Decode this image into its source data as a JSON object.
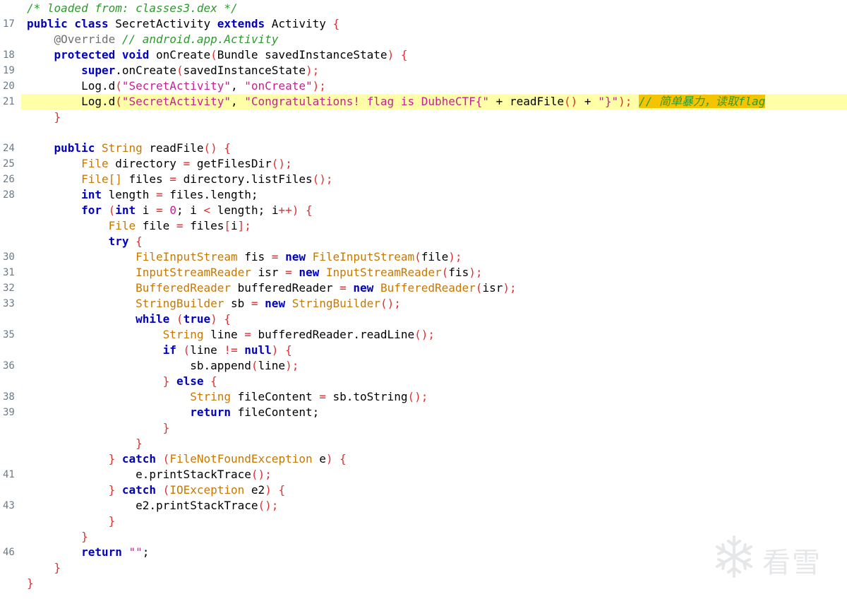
{
  "editor": {
    "lines": [
      {
        "num": "",
        "hl": false,
        "tokens": [
          {
            "t": "/* loaded from: classes3.dex */",
            "c": "cmt"
          }
        ]
      },
      {
        "num": "17",
        "hl": false,
        "tokens": [
          {
            "t": "public class",
            "c": "kw"
          },
          {
            "t": " SecretActivity ",
            "c": "id"
          },
          {
            "t": "extends",
            "c": "kw"
          },
          {
            "t": " Activity ",
            "c": "id"
          },
          {
            "t": "{",
            "c": "pn"
          }
        ]
      },
      {
        "num": "",
        "hl": false,
        "tokens": [
          {
            "t": "    "
          },
          {
            "t": "@Override",
            "c": "ann"
          },
          {
            "t": " // android.app.Activity",
            "c": "cmt"
          }
        ]
      },
      {
        "num": "18",
        "hl": false,
        "tokens": [
          {
            "t": "    "
          },
          {
            "t": "protected void",
            "c": "kw"
          },
          {
            "t": " onCreate",
            "c": "id"
          },
          {
            "t": "(",
            "c": "pn"
          },
          {
            "t": "Bundle savedInstanceState",
            "c": "id"
          },
          {
            "t": ") {",
            "c": "pn"
          }
        ]
      },
      {
        "num": "19",
        "hl": false,
        "tokens": [
          {
            "t": "        "
          },
          {
            "t": "super",
            "c": "kw"
          },
          {
            "t": ".onCreate",
            "c": "id"
          },
          {
            "t": "(",
            "c": "pn"
          },
          {
            "t": "savedInstanceState",
            "c": "id"
          },
          {
            "t": ");",
            "c": "pn"
          }
        ]
      },
      {
        "num": "20",
        "hl": false,
        "tokens": [
          {
            "t": "        "
          },
          {
            "t": "Log.d",
            "c": "id"
          },
          {
            "t": "(",
            "c": "pn"
          },
          {
            "t": "\"SecretActivity\"",
            "c": "str"
          },
          {
            "t": ", ",
            "c": "id"
          },
          {
            "t": "\"onCreate\"",
            "c": "str"
          },
          {
            "t": ");",
            "c": "pn"
          }
        ]
      },
      {
        "num": "21",
        "hl": true,
        "tokens": [
          {
            "t": "        "
          },
          {
            "t": "Log.d",
            "c": "id"
          },
          {
            "t": "(",
            "c": "pn"
          },
          {
            "t": "\"SecretActivity\"",
            "c": "str"
          },
          {
            "t": ", ",
            "c": "id"
          },
          {
            "t": "\"Congratulations! flag is DubheCTF{\"",
            "c": "str"
          },
          {
            "t": " + ",
            "c": "id"
          },
          {
            "t": "readFile",
            "c": "id"
          },
          {
            "t": "()",
            "c": "pn"
          },
          {
            "t": " + ",
            "c": "id"
          },
          {
            "t": "\"}\"",
            "c": "str"
          },
          {
            "t": ");",
            "c": "pn"
          },
          {
            "t": " ",
            "c": "id"
          },
          {
            "t": "// 简单暴力，读取flag",
            "c": "hcmt"
          }
        ]
      },
      {
        "num": "",
        "hl": false,
        "tokens": [
          {
            "t": "    "
          },
          {
            "t": "}",
            "c": "pn"
          }
        ]
      },
      {
        "num": "",
        "hl": false,
        "tokens": []
      },
      {
        "num": "24",
        "hl": false,
        "tokens": [
          {
            "t": "    "
          },
          {
            "t": "public",
            "c": "kw"
          },
          {
            "t": " "
          },
          {
            "t": "String",
            "c": "type"
          },
          {
            "t": " readFile",
            "c": "id"
          },
          {
            "t": "() {",
            "c": "pn"
          }
        ]
      },
      {
        "num": "25",
        "hl": false,
        "tokens": [
          {
            "t": "        "
          },
          {
            "t": "File",
            "c": "type"
          },
          {
            "t": " directory ",
            "c": "id"
          },
          {
            "t": "=",
            "c": "op"
          },
          {
            "t": " getFilesDir",
            "c": "id"
          },
          {
            "t": "();",
            "c": "pn"
          }
        ]
      },
      {
        "num": "26",
        "hl": false,
        "tokens": [
          {
            "t": "        "
          },
          {
            "t": "File[]",
            "c": "type"
          },
          {
            "t": " files ",
            "c": "id"
          },
          {
            "t": "=",
            "c": "op"
          },
          {
            "t": " directory.listFiles",
            "c": "id"
          },
          {
            "t": "();",
            "c": "pn"
          }
        ]
      },
      {
        "num": "28",
        "hl": false,
        "tokens": [
          {
            "t": "        "
          },
          {
            "t": "int",
            "c": "kw"
          },
          {
            "t": " length ",
            "c": "id"
          },
          {
            "t": "=",
            "c": "op"
          },
          {
            "t": " files.length;",
            "c": "id"
          }
        ]
      },
      {
        "num": "",
        "hl": false,
        "tokens": [
          {
            "t": "        "
          },
          {
            "t": "for",
            "c": "kw"
          },
          {
            "t": " (",
            "c": "pn"
          },
          {
            "t": "int",
            "c": "kw"
          },
          {
            "t": " i ",
            "c": "id"
          },
          {
            "t": "=",
            "c": "op"
          },
          {
            "t": " "
          },
          {
            "t": "0",
            "c": "num"
          },
          {
            "t": "; i ",
            "c": "id"
          },
          {
            "t": "<",
            "c": "op"
          },
          {
            "t": " length; i",
            "c": "id"
          },
          {
            "t": "++",
            "c": "op"
          },
          {
            "t": ") {",
            "c": "pn"
          }
        ]
      },
      {
        "num": "",
        "hl": false,
        "tokens": [
          {
            "t": "            "
          },
          {
            "t": "File",
            "c": "type"
          },
          {
            "t": " file ",
            "c": "id"
          },
          {
            "t": "=",
            "c": "op"
          },
          {
            "t": " files",
            "c": "id"
          },
          {
            "t": "[",
            "c": "pn"
          },
          {
            "t": "i",
            "c": "id"
          },
          {
            "t": "];",
            "c": "pn"
          }
        ]
      },
      {
        "num": "",
        "hl": false,
        "tokens": [
          {
            "t": "            "
          },
          {
            "t": "try",
            "c": "kw"
          },
          {
            "t": " {",
            "c": "pn"
          }
        ]
      },
      {
        "num": "30",
        "hl": false,
        "tokens": [
          {
            "t": "                "
          },
          {
            "t": "FileInputStream",
            "c": "type"
          },
          {
            "t": " fis ",
            "c": "id"
          },
          {
            "t": "=",
            "c": "op"
          },
          {
            "t": " "
          },
          {
            "t": "new",
            "c": "kw"
          },
          {
            "t": " "
          },
          {
            "t": "FileInputStream",
            "c": "type"
          },
          {
            "t": "(",
            "c": "pn"
          },
          {
            "t": "file",
            "c": "id"
          },
          {
            "t": ");",
            "c": "pn"
          }
        ]
      },
      {
        "num": "31",
        "hl": false,
        "tokens": [
          {
            "t": "                "
          },
          {
            "t": "InputStreamReader",
            "c": "type"
          },
          {
            "t": " isr ",
            "c": "id"
          },
          {
            "t": "=",
            "c": "op"
          },
          {
            "t": " "
          },
          {
            "t": "new",
            "c": "kw"
          },
          {
            "t": " "
          },
          {
            "t": "InputStreamReader",
            "c": "type"
          },
          {
            "t": "(",
            "c": "pn"
          },
          {
            "t": "fis",
            "c": "id"
          },
          {
            "t": ");",
            "c": "pn"
          }
        ]
      },
      {
        "num": "32",
        "hl": false,
        "tokens": [
          {
            "t": "                "
          },
          {
            "t": "BufferedReader",
            "c": "type"
          },
          {
            "t": " bufferedReader ",
            "c": "id"
          },
          {
            "t": "=",
            "c": "op"
          },
          {
            "t": " "
          },
          {
            "t": "new",
            "c": "kw"
          },
          {
            "t": " "
          },
          {
            "t": "BufferedReader",
            "c": "type"
          },
          {
            "t": "(",
            "c": "pn"
          },
          {
            "t": "isr",
            "c": "id"
          },
          {
            "t": ");",
            "c": "pn"
          }
        ]
      },
      {
        "num": "33",
        "hl": false,
        "tokens": [
          {
            "t": "                "
          },
          {
            "t": "StringBuilder",
            "c": "type"
          },
          {
            "t": " sb ",
            "c": "id"
          },
          {
            "t": "=",
            "c": "op"
          },
          {
            "t": " "
          },
          {
            "t": "new",
            "c": "kw"
          },
          {
            "t": " "
          },
          {
            "t": "StringBuilder",
            "c": "type"
          },
          {
            "t": "();",
            "c": "pn"
          }
        ]
      },
      {
        "num": "",
        "hl": false,
        "tokens": [
          {
            "t": "                "
          },
          {
            "t": "while",
            "c": "kw"
          },
          {
            "t": " (",
            "c": "pn"
          },
          {
            "t": "true",
            "c": "kw"
          },
          {
            "t": ") {",
            "c": "pn"
          }
        ]
      },
      {
        "num": "35",
        "hl": false,
        "tokens": [
          {
            "t": "                    "
          },
          {
            "t": "String",
            "c": "type"
          },
          {
            "t": " line ",
            "c": "id"
          },
          {
            "t": "=",
            "c": "op"
          },
          {
            "t": " bufferedReader.readLine",
            "c": "id"
          },
          {
            "t": "();",
            "c": "pn"
          }
        ]
      },
      {
        "num": "",
        "hl": false,
        "tokens": [
          {
            "t": "                    "
          },
          {
            "t": "if",
            "c": "kw"
          },
          {
            "t": " (",
            "c": "pn"
          },
          {
            "t": "line ",
            "c": "id"
          },
          {
            "t": "!=",
            "c": "op"
          },
          {
            "t": " "
          },
          {
            "t": "null",
            "c": "kw"
          },
          {
            "t": ") {",
            "c": "pn"
          }
        ]
      },
      {
        "num": "36",
        "hl": false,
        "tokens": [
          {
            "t": "                        "
          },
          {
            "t": "sb.append",
            "c": "id"
          },
          {
            "t": "(",
            "c": "pn"
          },
          {
            "t": "line",
            "c": "id"
          },
          {
            "t": ");",
            "c": "pn"
          }
        ]
      },
      {
        "num": "",
        "hl": false,
        "tokens": [
          {
            "t": "                    "
          },
          {
            "t": "}",
            "c": "pn"
          },
          {
            "t": " "
          },
          {
            "t": "else",
            "c": "kw"
          },
          {
            "t": " {",
            "c": "pn"
          }
        ]
      },
      {
        "num": "38",
        "hl": false,
        "tokens": [
          {
            "t": "                        "
          },
          {
            "t": "String",
            "c": "type"
          },
          {
            "t": " fileContent ",
            "c": "id"
          },
          {
            "t": "=",
            "c": "op"
          },
          {
            "t": " sb.toString",
            "c": "id"
          },
          {
            "t": "();",
            "c": "pn"
          }
        ]
      },
      {
        "num": "39",
        "hl": false,
        "tokens": [
          {
            "t": "                        "
          },
          {
            "t": "return",
            "c": "kw"
          },
          {
            "t": " fileContent;",
            "c": "id"
          }
        ]
      },
      {
        "num": "",
        "hl": false,
        "tokens": [
          {
            "t": "                    "
          },
          {
            "t": "}",
            "c": "pn"
          }
        ]
      },
      {
        "num": "",
        "hl": false,
        "tokens": [
          {
            "t": "                "
          },
          {
            "t": "}",
            "c": "pn"
          }
        ]
      },
      {
        "num": "",
        "hl": false,
        "tokens": [
          {
            "t": "            "
          },
          {
            "t": "}",
            "c": "pn"
          },
          {
            "t": " "
          },
          {
            "t": "catch",
            "c": "kw"
          },
          {
            "t": " (",
            "c": "pn"
          },
          {
            "t": "FileNotFoundException",
            "c": "type"
          },
          {
            "t": " e",
            "c": "id"
          },
          {
            "t": ") {",
            "c": "pn"
          }
        ]
      },
      {
        "num": "41",
        "hl": false,
        "tokens": [
          {
            "t": "                "
          },
          {
            "t": "e.printStackTrace",
            "c": "id"
          },
          {
            "t": "();",
            "c": "pn"
          }
        ]
      },
      {
        "num": "",
        "hl": false,
        "tokens": [
          {
            "t": "            "
          },
          {
            "t": "}",
            "c": "pn"
          },
          {
            "t": " "
          },
          {
            "t": "catch",
            "c": "kw"
          },
          {
            "t": " (",
            "c": "pn"
          },
          {
            "t": "IOException",
            "c": "type"
          },
          {
            "t": " e2",
            "c": "id"
          },
          {
            "t": ") {",
            "c": "pn"
          }
        ]
      },
      {
        "num": "43",
        "hl": false,
        "tokens": [
          {
            "t": "                "
          },
          {
            "t": "e2.printStackTrace",
            "c": "id"
          },
          {
            "t": "();",
            "c": "pn"
          }
        ]
      },
      {
        "num": "",
        "hl": false,
        "tokens": [
          {
            "t": "            "
          },
          {
            "t": "}",
            "c": "pn"
          }
        ]
      },
      {
        "num": "",
        "hl": false,
        "tokens": [
          {
            "t": "        "
          },
          {
            "t": "}",
            "c": "pn"
          }
        ]
      },
      {
        "num": "46",
        "hl": false,
        "tokens": [
          {
            "t": "        "
          },
          {
            "t": "return",
            "c": "kw"
          },
          {
            "t": " "
          },
          {
            "t": "\"\"",
            "c": "str"
          },
          {
            "t": ";",
            "c": "id"
          }
        ]
      },
      {
        "num": "",
        "hl": false,
        "tokens": [
          {
            "t": "    "
          },
          {
            "t": "}",
            "c": "pn"
          }
        ]
      },
      {
        "num": "",
        "hl": false,
        "tokens": [
          {
            "t": "}",
            "c": "pn"
          }
        ]
      }
    ]
  },
  "watermark": {
    "text": "看雪",
    "icon": "snowflake-icon"
  },
  "colors": {
    "keyword": "#0000c0",
    "type": "#c87800",
    "string": "#c81e96",
    "comment": "#2e9a2e",
    "annotation": "#707070",
    "punctuation": "#e03030",
    "line_number": "#6a7a88",
    "highlight_line": "#ffffa8",
    "highlight_comment": "#f4c400"
  }
}
